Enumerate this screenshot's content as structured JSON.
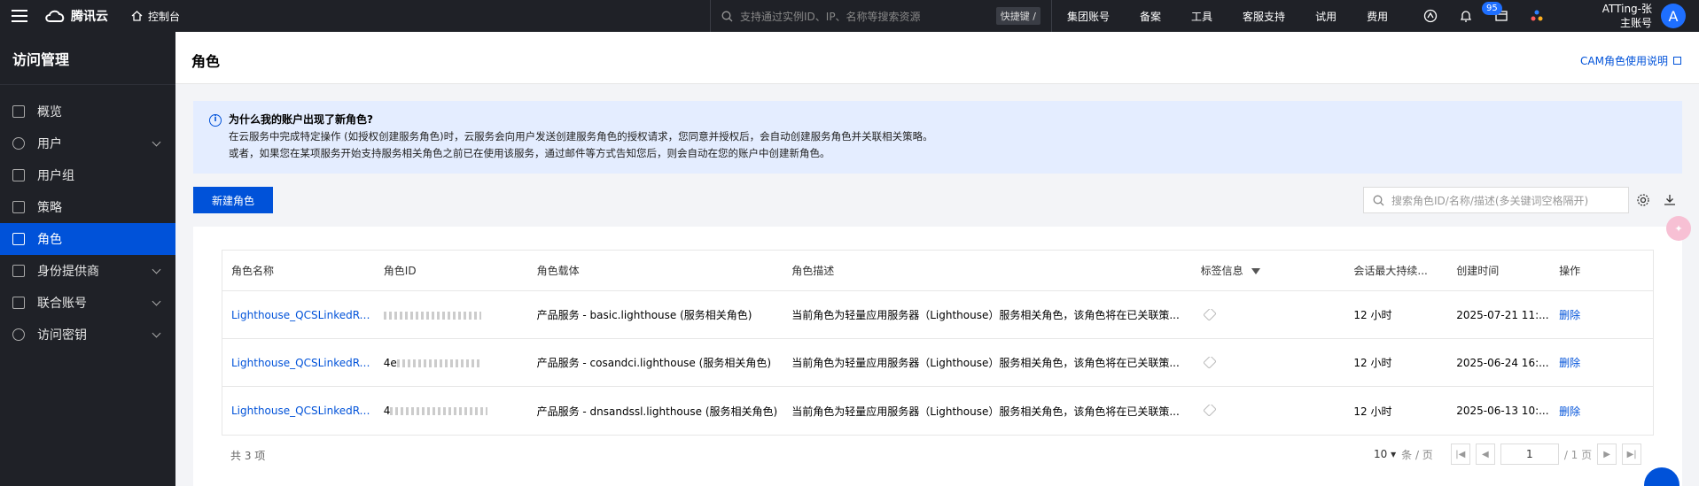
{
  "topbar": {
    "brand": "腾讯云",
    "console": "控制台",
    "search_placeholder": "支持通过实例ID、IP、名称等搜索资源",
    "shortcut": "快捷键 /",
    "links": [
      "集团账号",
      "备案",
      "工具",
      "客服支持",
      "试用",
      "费用"
    ],
    "notification_count": "95",
    "account_line1": "ATTing-张",
    "account_line2": "主账号",
    "avatar_letter": "A"
  },
  "sidebar": {
    "title": "访问管理",
    "items": [
      {
        "label": "概览",
        "expandable": false
      },
      {
        "label": "用户",
        "expandable": true
      },
      {
        "label": "用户组",
        "expandable": false
      },
      {
        "label": "策略",
        "expandable": false
      },
      {
        "label": "角色",
        "expandable": false,
        "active": true
      },
      {
        "label": "身份提供商",
        "expandable": true
      },
      {
        "label": "联合账号",
        "expandable": true
      },
      {
        "label": "访问密钥",
        "expandable": true
      }
    ]
  },
  "header": {
    "title": "角色",
    "doc_link": "CAM角色使用说明"
  },
  "notice": {
    "title": "为什么我的账户出现了新角色?",
    "line1": "在云服务中完成特定操作 (如授权创建服务角色)时，云服务会向用户发送创建服务角色的授权请求，您同意并授权后，会自动创建服务角色并关联相关策略。",
    "line2": "或者，如果您在某项服务开始支持服务相关角色之前已在使用该服务，通过邮件等方式告知您后，则会自动在您的账户中创建新角色。"
  },
  "toolbar": {
    "create_label": "新建角色",
    "search_placeholder": "搜索角色ID/名称/描述(多关键词空格隔开)"
  },
  "table": {
    "columns": [
      "角色名称",
      "角色ID",
      "角色载体",
      "角色描述",
      "标签信息",
      "会话最大持续...",
      "创建时间",
      "操作"
    ],
    "rows": [
      {
        "name": "Lighthouse_QCSLinkedRoleI",
        "id": "",
        "carrier": "产品服务 - basic.lighthouse (服务相关角色)",
        "desc": "当前角色为轻量应用服务器（Lighthouse）服务相关角色，该角色将在已关联策...",
        "session": "12 小时",
        "created": "2025-07-21 11:...",
        "action": "删除"
      },
      {
        "name": "Lighthouse_QCSLinkedRoleI",
        "id": "4e",
        "carrier": "产品服务 - cosandci.lighthouse (服务相关角色)",
        "desc": "当前角色为轻量应用服务器（Lighthouse）服务相关角色，该角色将在已关联策...",
        "session": "12 小时",
        "created": "2025-06-24 16:...",
        "action": "删除"
      },
      {
        "name": "Lighthouse_QCSLinkedRoleI",
        "id": "4",
        "carrier": "产品服务 - dnsandssl.lighthouse (服务相关角色)",
        "desc": "当前角色为轻量应用服务器（Lighthouse）服务相关角色，该角色将在已关联策...",
        "session": "12 小时",
        "created": "2025-06-13 10:...",
        "action": "删除"
      }
    ]
  },
  "pagination": {
    "total": "共 3 项",
    "page_size": "10",
    "per_page": "条 / 页",
    "current_page": "1",
    "total_pages": "/ 1 页"
  },
  "colors": {
    "primary": "#0052d9",
    "topbar": "#1f2127",
    "notice_bg": "#e4edff"
  }
}
